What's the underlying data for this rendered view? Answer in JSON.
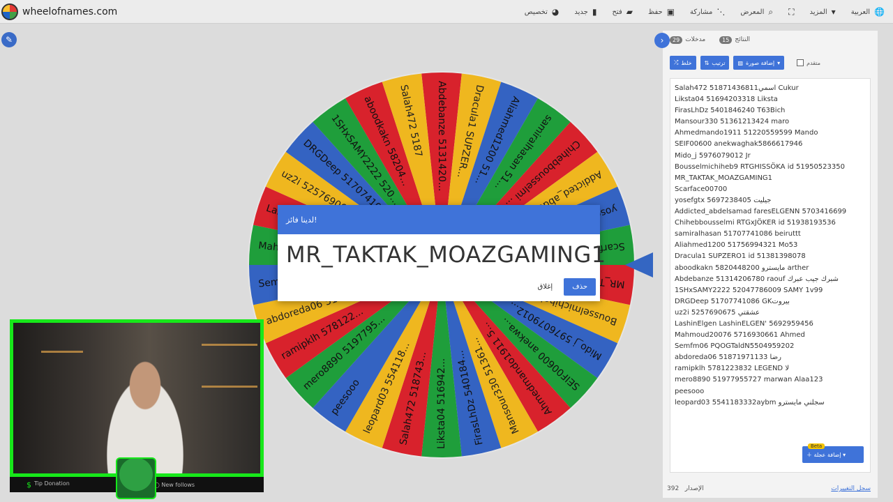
{
  "header": {
    "brand": "wheelofnames.com",
    "menu": [
      {
        "label": "العربية",
        "icon": "globe-icon"
      },
      {
        "label": "المزيد",
        "icon": "chevron-down-icon"
      },
      {
        "label": "",
        "icon": "fullscreen-icon"
      },
      {
        "label": "المعرض",
        "icon": "search-icon"
      },
      {
        "label": "مشاركة",
        "icon": "share-icon"
      },
      {
        "label": "حفظ",
        "icon": "save-icon"
      },
      {
        "label": "فتح",
        "icon": "folder-icon"
      },
      {
        "label": "جديد",
        "icon": "file-icon"
      },
      {
        "label": "تخصيص",
        "icon": "palette-icon"
      }
    ]
  },
  "wheel": {
    "colors": {
      "red": "#d8222c",
      "yellow": "#efb71f",
      "blue": "#3463c2",
      "green": "#1f9e3b"
    },
    "labels": [
      "Abdebanze 5131420...",
      "Dracula1 SUPZER...",
      "Aliahmed1200 51...",
      "samiralhasan 51...",
      "Chihebbousselmi ...",
      "Addicted_abdelsam...",
      "yosefgtx 5697238...",
      "Scarface00700",
      "MR_TAKTAK_MOAZGAM...",
      "Bousselmichiheb",
      "Mido_j 5976079012...",
      "SEIF00600 anekwa...",
      "Ahmedmando1911 5...",
      "Mansour330 51361...",
      "FirasLhDz 540184...",
      "Liksta04 516942...",
      "Salah472 518743...",
      "leopard03 554118...",
      "peesooo",
      "mero8890 5197795...",
      "ramipklh 578122...",
      "abdoreda06 5187...",
      "Semfm06 PQOGTaldN...",
      "Mahmoud20076 57...",
      "LashinElgen",
      "uz2i 5257690675",
      "DRGDeep 51707410...",
      "1SHxSAMY2222 520...",
      "aboodkakn 58204...",
      "Salah472 5187"
    ]
  },
  "dialog": {
    "title": "لدينا فائز!",
    "winner": "MR_TAKTAK_MOAZGAMING1",
    "close_label": "إغلاق",
    "remove_label": "حذف"
  },
  "panel": {
    "tabs": [
      {
        "label": "مدخلات",
        "count": "29"
      },
      {
        "label": "النتائج",
        "count": "15"
      }
    ],
    "toolbar": {
      "shuffle_label": "خلط",
      "sort_label": "ترتيب",
      "add_image_label": "إضافة صورة",
      "advanced_label": "متقدم"
    },
    "entries": [
      "Salah472 51871436811اسمي Cukur",
      "Liksta04 51694203318 Liksta",
      "FirasLhDz 5401846240 T63Bich",
      "Mansour330 51361213424 maro",
      "Ahmedmando1911 51220559599 Mando",
      "SEIF00600 anekwaghak5866617946",
      "Mido_j 5976079012 Jr",
      "Bousselmichiheb9 RTGHISSÖKA id 51950523350",
      "MR_TAKTAK_MOAZGAMING1",
      "Scarface00700",
      "yosefgtx 5697238405 جيليت",
      "Addicted_abdelsamad faresELGENN 5703416699",
      "Chihebbousselmi RTGxJÖKER id 51938193536",
      "samiralhasan 51707741086 beiruttt",
      "Aliahmed1200 51756994321 Mo53",
      "Dracula1 SUPZERO1 id 51381398078",
      "aboodkakn 5820448200 مايسترو arther",
      "Abdebanze 51314206780 raouf شبرك جيب عبرك",
      "1SHxSAMY2222 52047786009 SAMY 1v99",
      "DRGDeep 51707741086 GKبيروت",
      "uz2i 5257690675 عشقتي",
      "LashinElgen LashinELGEN' 5692959456",
      "Mahmoud20076 5716930661 Ahmed",
      "Semfm06 PQOGTaldN5504959202",
      "abdoreda06 51871971133 رضا",
      "ramipklh 5781223832 LEGEND لا",
      "mero8890 51977955727 marwan Alaa123",
      "peesooo",
      "leopard03 5541183332aybm سجلني مايسترو"
    ],
    "add_wheel_label": "إضافة عجلة",
    "beta_label": "Beta",
    "version_label": "الإصدار",
    "version_value": "392",
    "changelog_label": "سجل التغييرات"
  },
  "webcam": {
    "tip_label": "Tip Donation",
    "follows_label": "New follows"
  }
}
